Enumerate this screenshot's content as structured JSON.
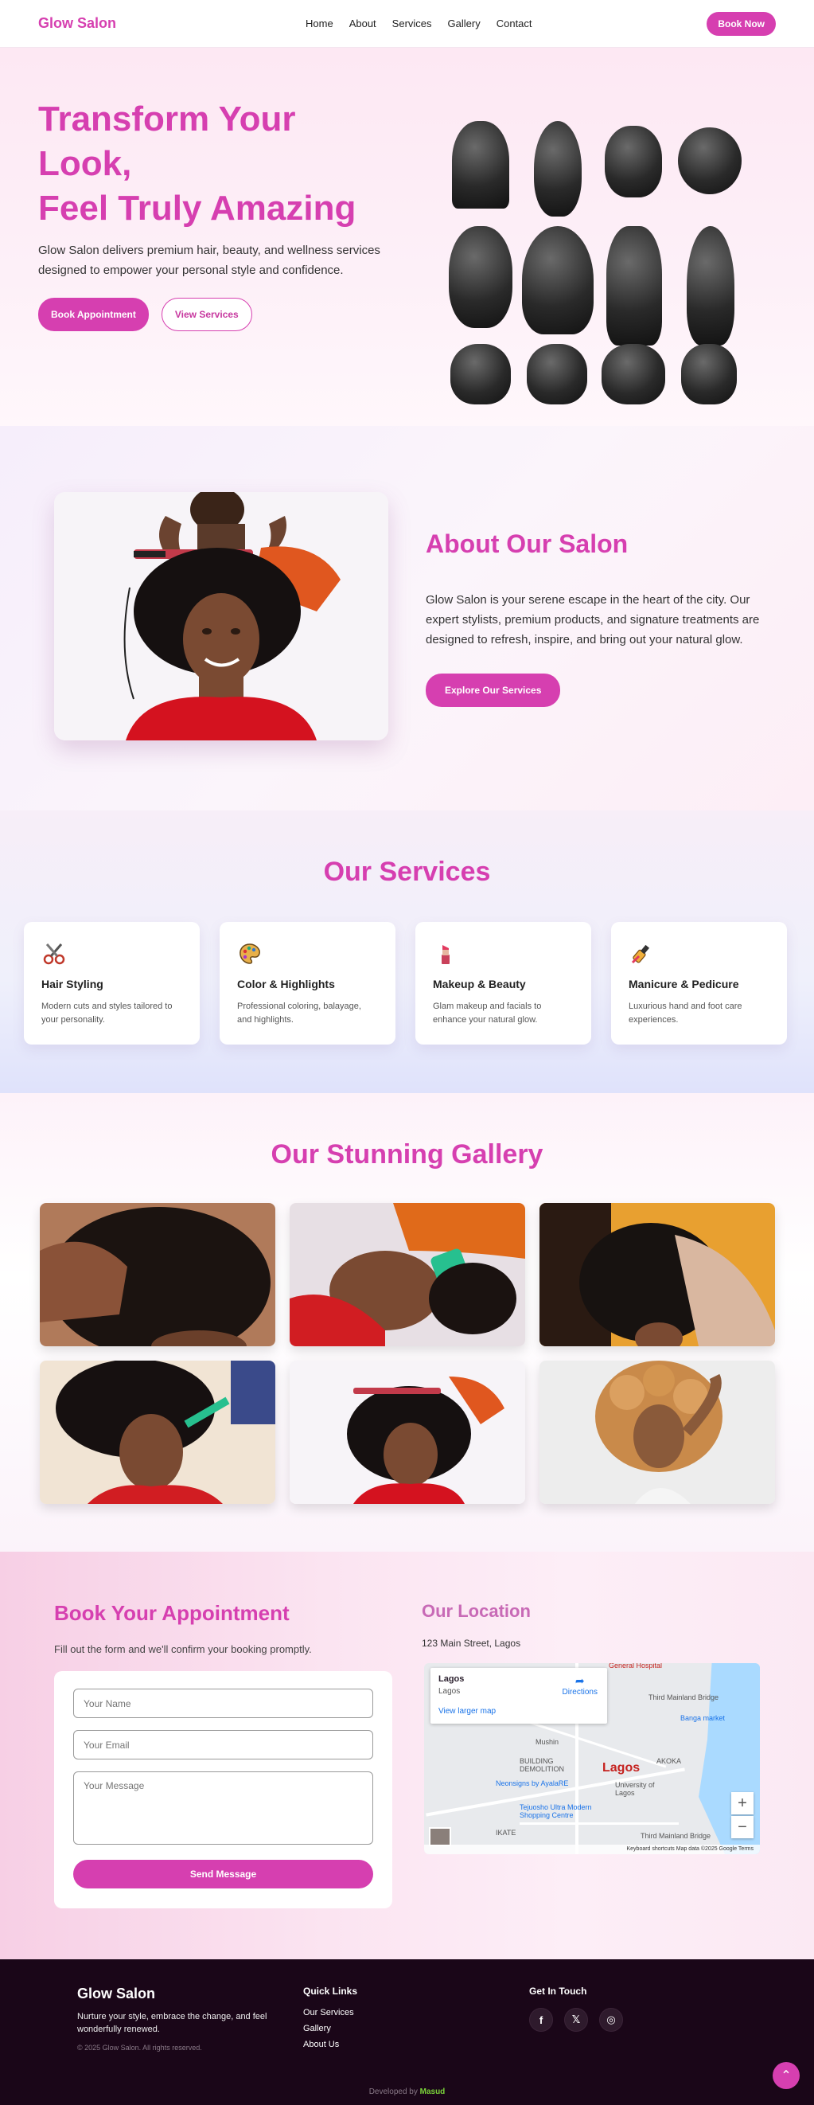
{
  "nav": {
    "brand": "Glow Salon",
    "links": [
      "Home",
      "About",
      "Services",
      "Gallery",
      "Contact"
    ],
    "cta": "Book Now"
  },
  "hero": {
    "title_line1": "Transform Your",
    "title_line2": "Look,",
    "title_line3": "Feel Truly Amazing",
    "text": "Glow Salon delivers premium hair, beauty, and wellness services designed to empower your personal style and confidence.",
    "primary_btn": "Book Appointment",
    "secondary_btn": "View Services"
  },
  "about": {
    "title": "About Our Salon",
    "text": "Glow Salon is your serene escape in the heart of the city. Our expert stylists, premium products, and signature treatments are designed to refresh, inspire, and bring out your natural glow.",
    "btn": "Explore Our Services"
  },
  "services": {
    "title": "Our Services",
    "items": [
      {
        "icon": "scissors-icon",
        "name": "Hair Styling",
        "desc": "Modern cuts and styles tailored to your personality."
      },
      {
        "icon": "palette-icon",
        "name": "Color & Highlights",
        "desc": "Professional coloring, balayage, and highlights."
      },
      {
        "icon": "lipstick-icon",
        "name": "Makeup & Beauty",
        "desc": "Glam makeup and facials to enhance your natural glow."
      },
      {
        "icon": "nail-polish-icon",
        "name": "Manicure & Pedicure",
        "desc": "Luxurious hand and foot care experiences."
      }
    ]
  },
  "gallery": {
    "title": "Our Stunning Gallery"
  },
  "booking": {
    "title": "Book Your Appointment",
    "lead": "Fill out the form and we'll confirm your booking promptly.",
    "name_placeholder": "Your Name",
    "email_placeholder": "Your Email",
    "message_placeholder": "Your Message",
    "submit": "Send Message"
  },
  "location": {
    "title": "Our Location",
    "address": "123 Main Street, Lagos",
    "map": {
      "place": "Lagos",
      "place_sub": "Lagos",
      "larger_map": "View larger map",
      "directions": "Directions",
      "city_label": "Lagos",
      "labels": [
        "General Hospital",
        "Third Mainland Bridge",
        "Banga market",
        "AKOKA",
        "University of Lagos",
        "Neonsigns by AyalaRE",
        "Tejuosho Ultra Modern Shopping Centre",
        "IKATE",
        "BUILDING DEMOLITION",
        "Mushin",
        "Third Mainland Bridge"
      ],
      "footer": "Keyboard shortcuts   Map data ©2025 Google   Terms"
    }
  },
  "footer": {
    "brand": "Glow Salon",
    "tagline": "Nurture your style, embrace the change, and feel wonderfully renewed.",
    "copyright": "© 2025 Glow Salon. All rights reserved.",
    "quick_links_title": "Quick Links",
    "quick_links": [
      "Our Services",
      "Gallery",
      "About Us"
    ],
    "contact_title": "Get In Touch",
    "socials": [
      "facebook-icon",
      "twitter-icon",
      "instagram-icon"
    ],
    "dev_prefix": "Developed by",
    "dev_name": "Masud"
  },
  "colors": {
    "accent": "#d63fb0",
    "footer_bg": "#1a0618",
    "dev_name": "#7bd43a"
  }
}
